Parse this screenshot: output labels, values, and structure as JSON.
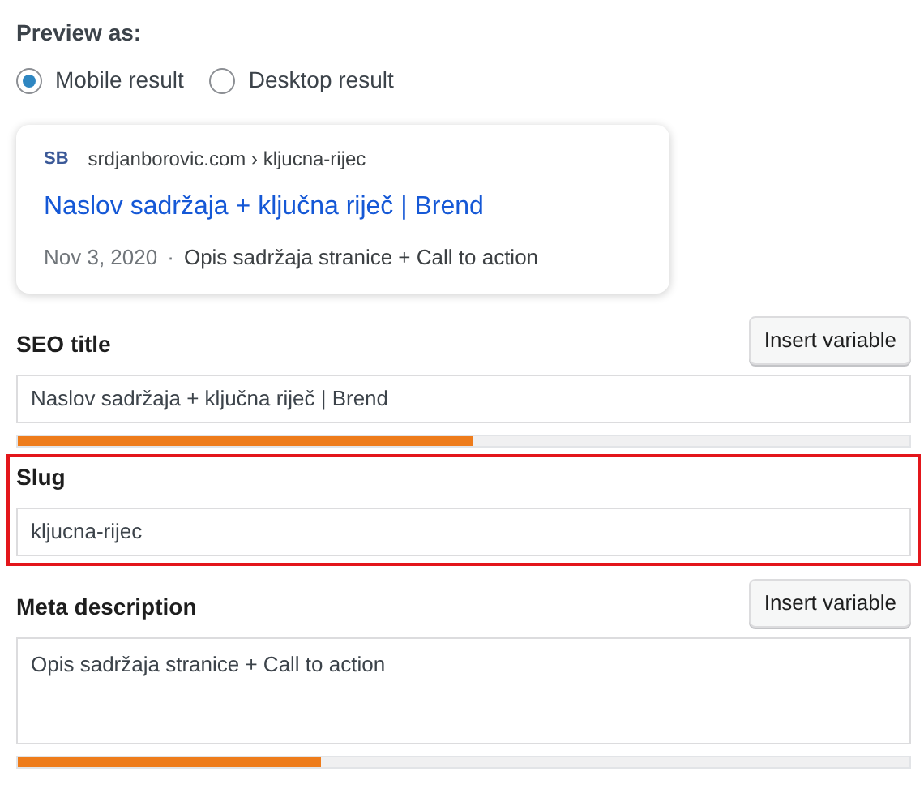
{
  "preview": {
    "heading": "Preview as:",
    "options": [
      {
        "label": "Mobile result",
        "selected": true
      },
      {
        "label": "Desktop result",
        "selected": false
      }
    ]
  },
  "snippet": {
    "logo": "SB",
    "breadcrumb": "srdjanborovic.com › kljucna-rijec",
    "title": "Naslov sadržaja + ključna riječ | Brend",
    "date": "Nov 3, 2020",
    "separator": "·",
    "description": "Opis sadržaja stranice + Call to action"
  },
  "fields": [
    {
      "kind": "input",
      "label": "SEO title",
      "button": "Insert variable",
      "value": "Naslov sadržaja + ključna riječ | Brend",
      "level": 0.51,
      "highlighted": false
    },
    {
      "kind": "input",
      "label": "Slug",
      "value": "kljucna-rijec",
      "highlighted": true
    },
    {
      "kind": "textarea",
      "label": "Meta description",
      "button": "Insert variable",
      "value": "Opis sadržaja stranice + Call to action",
      "level": 0.34,
      "highlighted": false
    }
  ]
}
